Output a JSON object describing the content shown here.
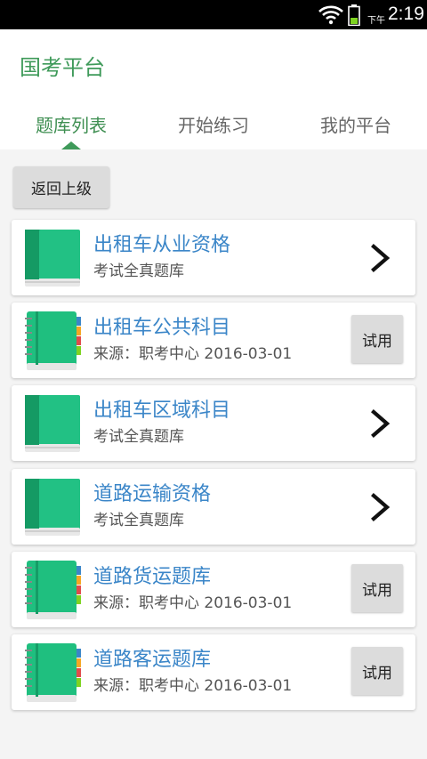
{
  "status_bar": {
    "ampm": "下午",
    "time": "2:19"
  },
  "header": {
    "title": "国考平台",
    "tabs": [
      {
        "label": "题库列表",
        "active": true
      },
      {
        "label": "开始练习",
        "active": false
      },
      {
        "label": "我的平台",
        "active": false
      }
    ]
  },
  "back_button": {
    "label": "返回上级"
  },
  "colors": {
    "accent": "#3f9a5a",
    "link": "#3b86c8",
    "book_green": "#1fbf7f"
  },
  "items": [
    {
      "name": "出租车从业资格",
      "subtitle": "考试全真题库",
      "icon": "book-icon",
      "action": "chevron"
    },
    {
      "name": "出租车公共科目",
      "subtitle": "来源：职考中心 2016-03-01",
      "icon": "notebook-icon",
      "action": "trial",
      "action_label": "试用"
    },
    {
      "name": "出租车区域科目",
      "subtitle": "考试全真题库",
      "icon": "book-icon",
      "action": "chevron"
    },
    {
      "name": "道路运输资格",
      "subtitle": "考试全真题库",
      "icon": "book-icon",
      "action": "chevron"
    },
    {
      "name": "道路货运题库",
      "subtitle": "来源：职考中心 2016-03-01",
      "icon": "notebook-icon",
      "action": "trial",
      "action_label": "试用"
    },
    {
      "name": "道路客运题库",
      "subtitle": "来源：职考中心 2016-03-01",
      "icon": "notebook-icon",
      "action": "trial",
      "action_label": "试用"
    }
  ]
}
